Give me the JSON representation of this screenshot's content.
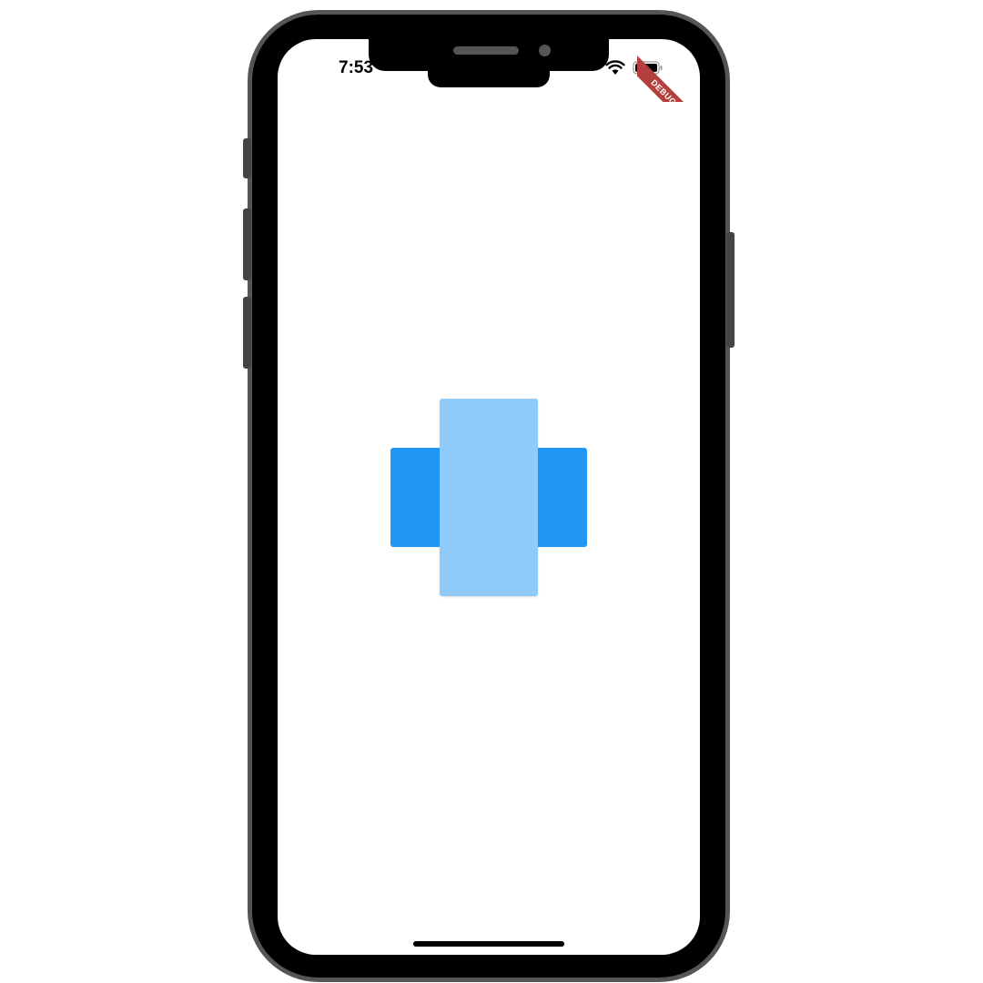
{
  "status_bar": {
    "time": "7:53"
  },
  "debug_banner": {
    "label": "DEBUG",
    "color": "#b3403f"
  },
  "shapes": {
    "horizontal_color": "#2196f3",
    "vertical_color": "#90caf9"
  },
  "icons": {
    "wifi": "wifi-icon",
    "battery": "battery-icon"
  }
}
